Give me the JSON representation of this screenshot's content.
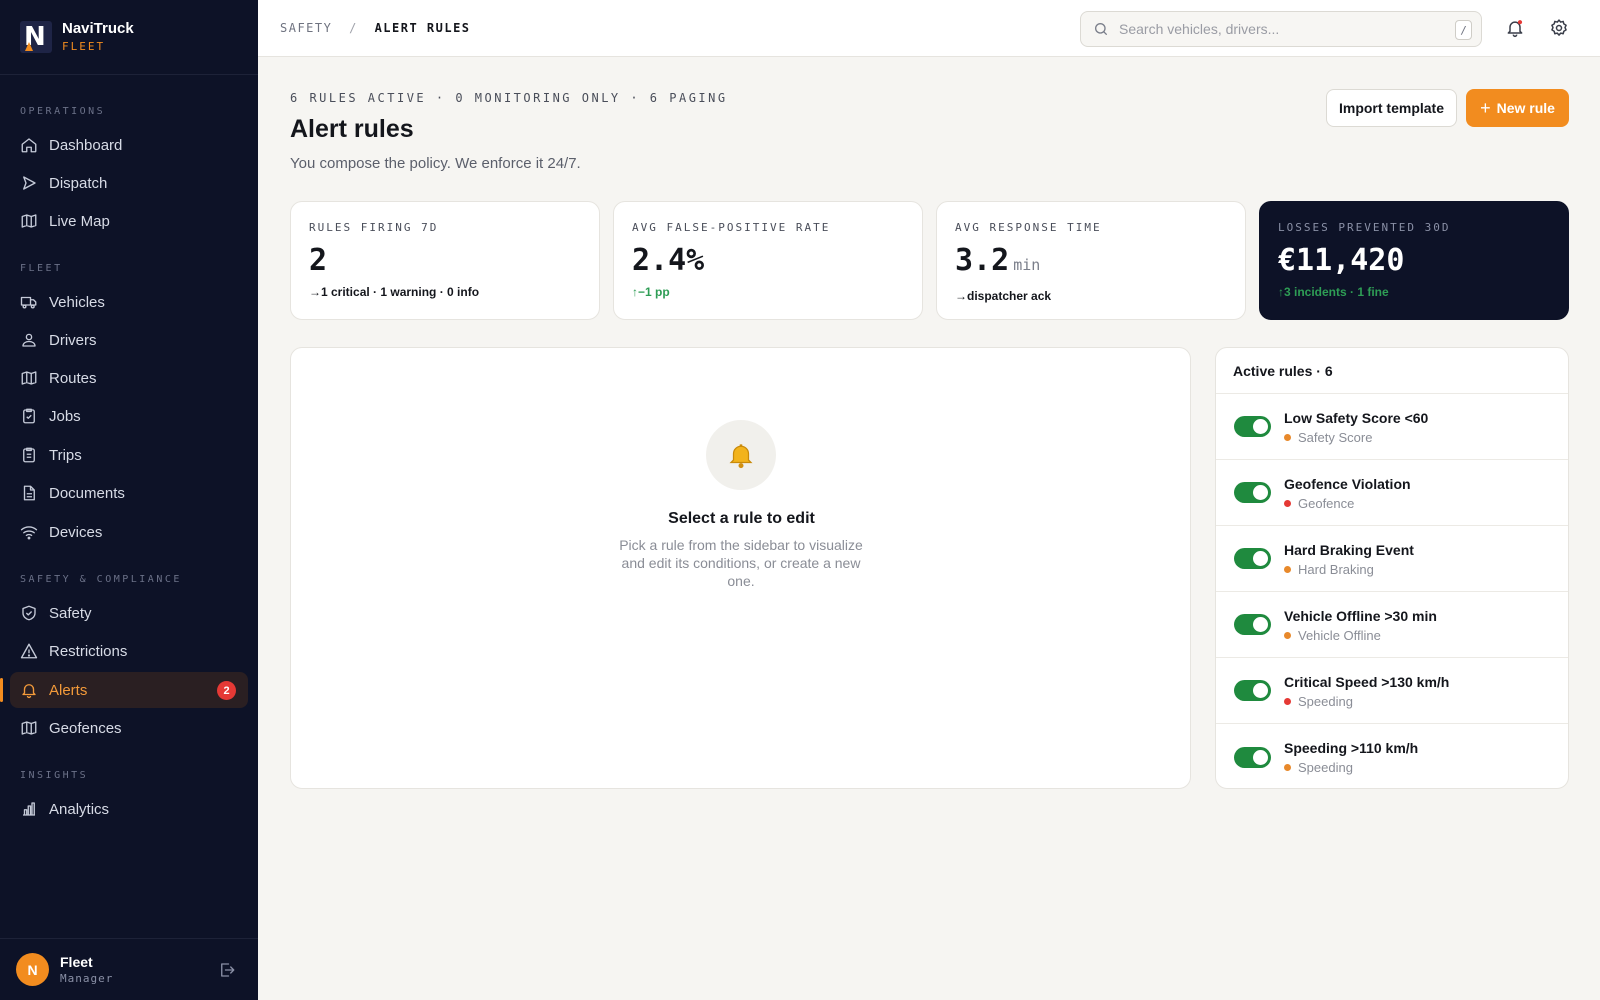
{
  "brand": {
    "name": "NaviTruck",
    "sub": "FLEET"
  },
  "sidebar": {
    "sections": [
      "OPERATIONS",
      "FLEET",
      "SAFETY & COMPLIANCE",
      "INSIGHTS"
    ],
    "items": [
      {
        "label": "Dashboard",
        "icon": "home-icon"
      },
      {
        "label": "Dispatch",
        "icon": "send-icon"
      },
      {
        "label": "Live Map",
        "icon": "map-icon"
      },
      {
        "label": "Vehicles",
        "icon": "truck-icon"
      },
      {
        "label": "Drivers",
        "icon": "driver-icon"
      },
      {
        "label": "Routes",
        "icon": "map-icon"
      },
      {
        "label": "Jobs",
        "icon": "clipboard-icon"
      },
      {
        "label": "Trips",
        "icon": "clipboard-icon"
      },
      {
        "label": "Documents",
        "icon": "document-icon"
      },
      {
        "label": "Devices",
        "icon": "wifi-icon"
      },
      {
        "label": "Safety",
        "icon": "shield-icon"
      },
      {
        "label": "Restrictions",
        "icon": "warning-icon"
      },
      {
        "label": "Alerts",
        "icon": "bell-icon",
        "badge": "2",
        "active": true
      },
      {
        "label": "Geofences",
        "icon": "map-icon"
      },
      {
        "label": "Analytics",
        "icon": "bar-chart-icon"
      }
    ]
  },
  "user": {
    "initial": "N",
    "name": "Fleet",
    "role": "Manager"
  },
  "header": {
    "breadcrumb_parent": "SAFETY",
    "breadcrumb_sep": "/",
    "breadcrumb_current": "ALERT RULES",
    "search_placeholder": "Search vehicles, drivers...",
    "search_shortcut": "/"
  },
  "page": {
    "summary": "6 RULES ACTIVE · 0 MONITORING ONLY · 6 PAGING",
    "title": "Alert rules",
    "subtitle": "You compose the policy. We enforce it 24/7.",
    "import_label": "Import template",
    "new_rule_label": "New rule"
  },
  "stats": [
    {
      "label": "RULES FIRING 7D",
      "value": "2",
      "unit": "",
      "note": "→1 critical · 1 warning · 0 info"
    },
    {
      "label": "AVG FALSE-POSITIVE RATE",
      "value": "2.4%",
      "unit": "",
      "note": "↑−1 pp"
    },
    {
      "label": "AVG RESPONSE TIME",
      "value": "3.2",
      "unit": "min",
      "note": "→dispatcher ack"
    },
    {
      "label": "LOSSES PREVENTED 30D",
      "value": "€11,420",
      "unit": "",
      "note": "↑3 incidents · 1 fine"
    }
  ],
  "editor": {
    "empty_title": "Select a rule to edit",
    "empty_body": "Pick a rule from the sidebar to visualize and edit its conditions, or create a new one."
  },
  "rules": {
    "header": "Active rules · 6",
    "items": [
      {
        "name": "Low Safety Score <60",
        "category": "Safety Score",
        "dot_color": "#e8892b",
        "enabled": true
      },
      {
        "name": "Geofence Violation",
        "category": "Geofence",
        "dot_color": "#e53935",
        "enabled": true
      },
      {
        "name": "Hard Braking Event",
        "category": "Hard Braking",
        "dot_color": "#e8892b",
        "enabled": true
      },
      {
        "name": "Vehicle Offline >30 min",
        "category": "Vehicle Offline",
        "dot_color": "#e8892b",
        "enabled": true
      },
      {
        "name": "Critical Speed >130 km/h",
        "category": "Speeding",
        "dot_color": "#e53935",
        "enabled": true
      },
      {
        "name": "Speeding >110 km/h",
        "category": "Speeding",
        "dot_color": "#e8892b",
        "enabled": true
      }
    ]
  },
  "colors": {
    "accent": "#f28c1f",
    "sidebar_bg": "#0d1227",
    "toggle_on": "#1f8a3e",
    "positive": "#2e9d55"
  }
}
